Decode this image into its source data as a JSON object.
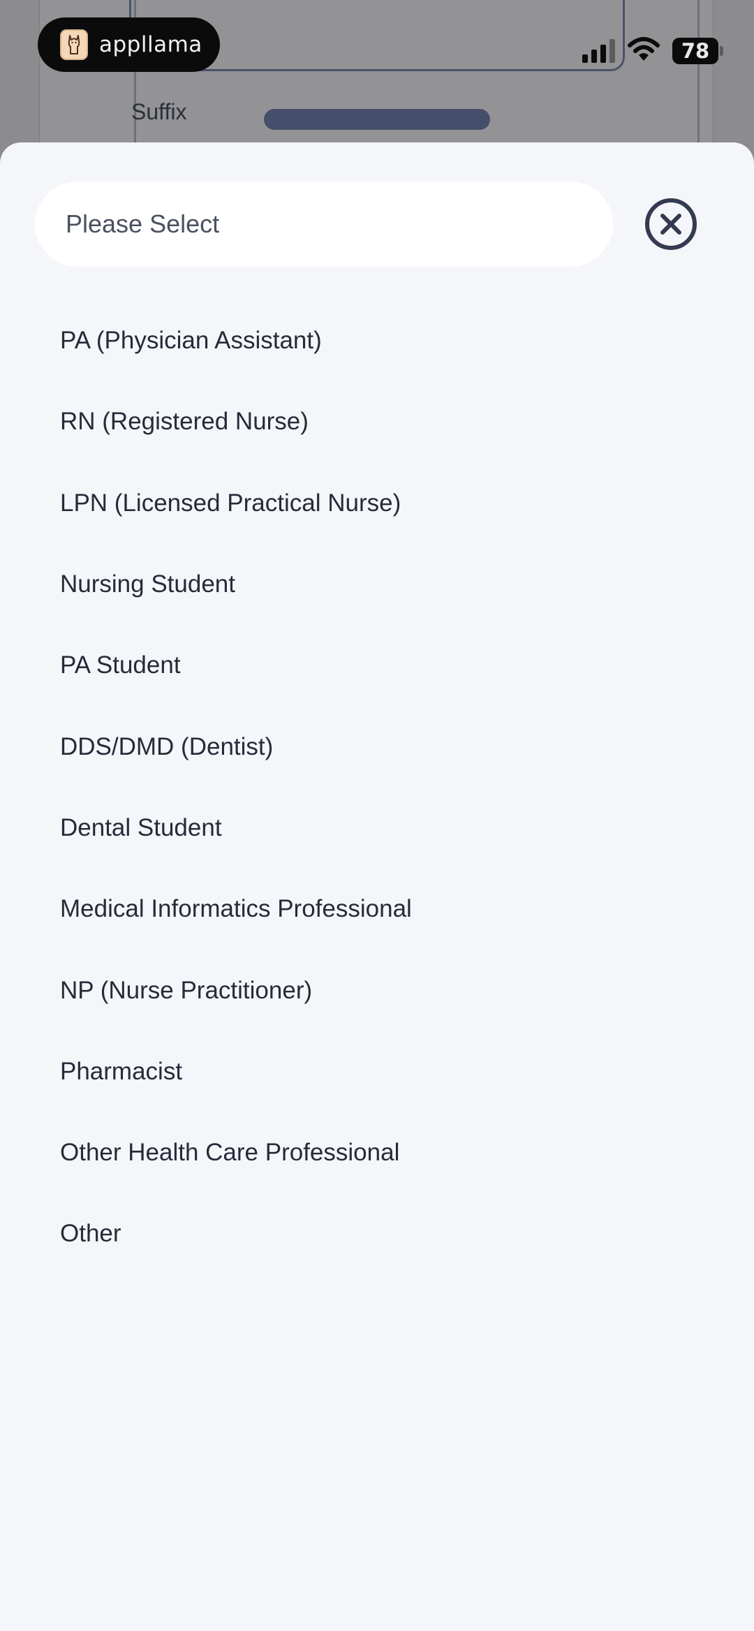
{
  "status_bar": {
    "app_name": "applama",
    "app_name_display": "appllama",
    "battery_level": "78",
    "signal_bars": 3,
    "signal_max": 4
  },
  "background": {
    "suffix_label": "Suffix"
  },
  "sheet": {
    "search": {
      "placeholder": "Please Select",
      "value": ""
    },
    "close_icon": "close-circle-icon",
    "options": [
      {
        "label": "PA (Physician Assistant)"
      },
      {
        "label": "RN (Registered Nurse)"
      },
      {
        "label": "LPN (Licensed Practical Nurse)"
      },
      {
        "label": "Nursing Student"
      },
      {
        "label": "PA Student"
      },
      {
        "label": "DDS/DMD (Dentist)"
      },
      {
        "label": "Dental Student"
      },
      {
        "label": "Medical Informatics Professional"
      },
      {
        "label": "NP (Nurse Practitioner)"
      },
      {
        "label": "Pharmacist"
      },
      {
        "label": "Other Health Care Professional"
      },
      {
        "label": "Other"
      }
    ]
  },
  "colors": {
    "sheet_bg": "#f5f6fa",
    "text": "#262b38",
    "close_icon": "#343a4f",
    "suffix_bar": "#454e6b"
  }
}
